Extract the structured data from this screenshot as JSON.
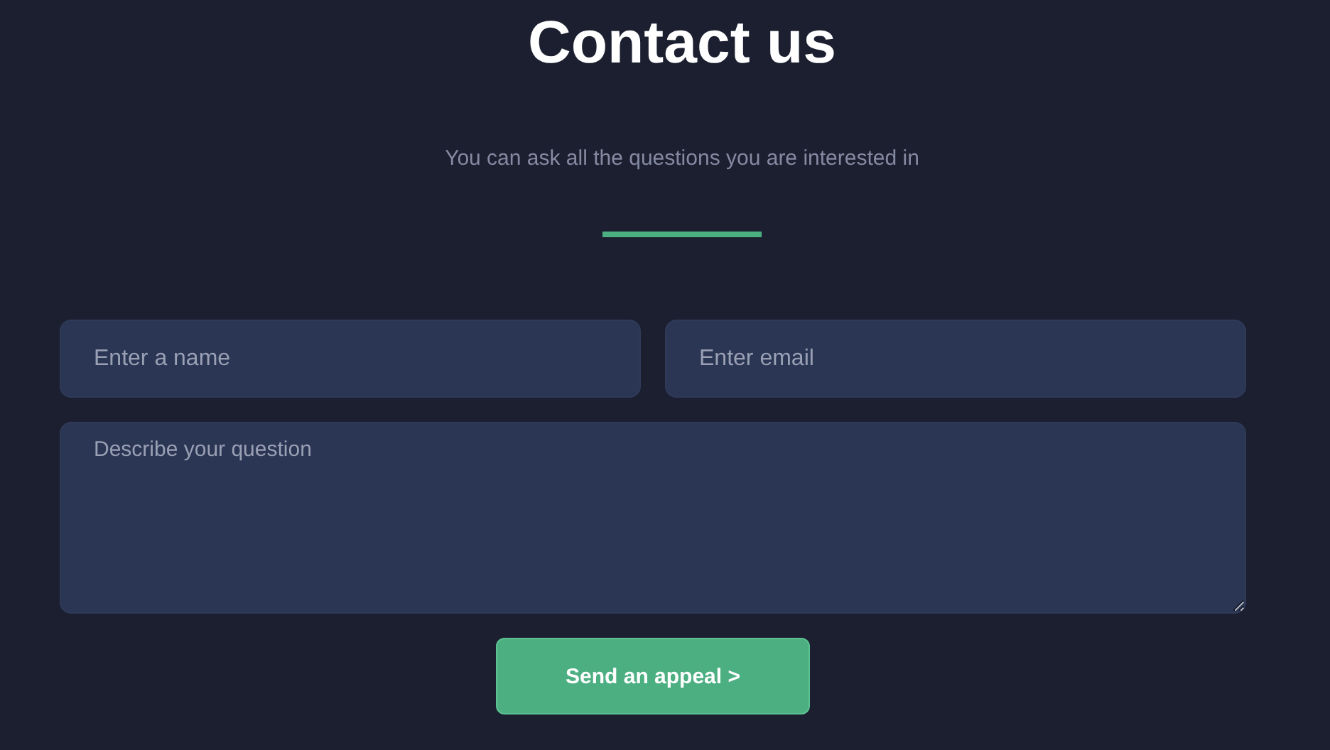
{
  "header": {
    "title": "Contact us",
    "subtitle": "You can ask all the questions you are interested in"
  },
  "form": {
    "name": {
      "placeholder": "Enter a name"
    },
    "email": {
      "placeholder": "Enter email"
    },
    "question": {
      "placeholder": "Describe your question"
    },
    "submit": "Send an appeal >"
  }
}
